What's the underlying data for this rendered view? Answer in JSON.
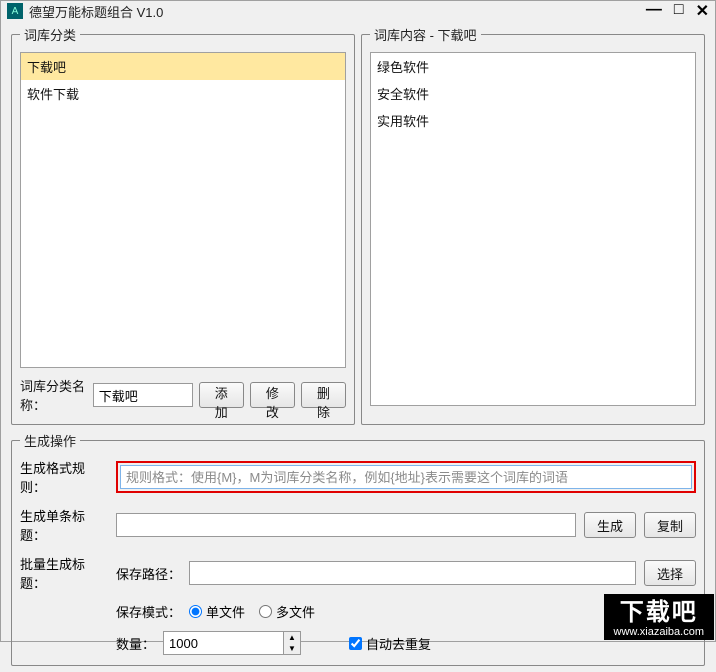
{
  "titlebar": {
    "title": "德望万能标题组合  V1.0"
  },
  "categoryPanel": {
    "legend": "词库分类",
    "items": [
      {
        "label": "下载吧",
        "selected": true
      },
      {
        "label": "软件下载",
        "selected": false
      }
    ],
    "nameLabel": "词库分类名称：",
    "nameValue": "下载吧",
    "addBtn": "添加",
    "editBtn": "修改",
    "delBtn": "删除"
  },
  "contentPanel": {
    "legend": "词库内容 - 下载吧",
    "items": [
      {
        "label": "绿色软件"
      },
      {
        "label": "安全软件"
      },
      {
        "label": "实用软件"
      }
    ]
  },
  "genPanel": {
    "legend": "生成操作",
    "ruleLabel": "生成格式规则：",
    "rulePlaceholder": "规则格式：使用{M}，M为词库分类名称，例如{地址}表示需要这个词库的词语",
    "singleLabel": "生成单条标题：",
    "genBtn": "生成",
    "copyBtn": "复制",
    "batchLabel": "批量生成标题：",
    "savePathLabel": "保存路径：",
    "choosePathBtn": "选择",
    "saveModeLabel": "保存模式：",
    "radioSingle": "单文件",
    "radioMulti": "多文件",
    "qtyLabel": "数量：",
    "qtyValue": "1000",
    "dedupLabel": "自动去重复"
  },
  "watermark": {
    "big": "下载吧",
    "url": "www.xiazaiba.com"
  }
}
